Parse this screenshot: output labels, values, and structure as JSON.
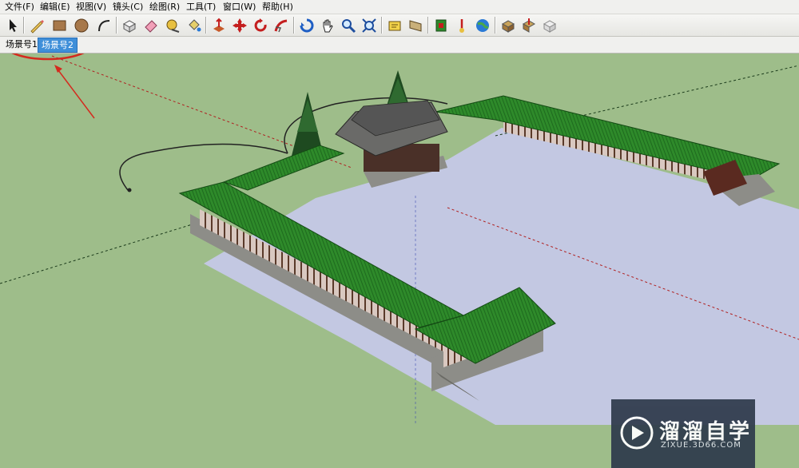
{
  "menu": [
    {
      "id": "file",
      "label": "文件(F)"
    },
    {
      "id": "edit",
      "label": "编辑(E)"
    },
    {
      "id": "view",
      "label": "视图(V)"
    },
    {
      "id": "camera",
      "label": "镜头(C)"
    },
    {
      "id": "draw",
      "label": "绘图(R)"
    },
    {
      "id": "tools",
      "label": "工具(T)"
    },
    {
      "id": "window",
      "label": "窗口(W)"
    },
    {
      "id": "help",
      "label": "帮助(H)"
    }
  ],
  "toolbar": {
    "tools": [
      {
        "name": "select-icon"
      },
      {
        "name": "pencil-line-icon"
      },
      {
        "name": "rectangle-icon"
      },
      {
        "name": "circle-icon"
      },
      {
        "name": "arc-icon"
      },
      {
        "name": "make-component-icon"
      },
      {
        "name": "eraser-icon"
      },
      {
        "name": "tape-measure-icon"
      },
      {
        "name": "paint-bucket-icon"
      },
      {
        "name": "push-pull-icon"
      },
      {
        "name": "move-icon"
      },
      {
        "name": "rotate-icon"
      },
      {
        "name": "follow-me-icon"
      },
      {
        "name": "orbit-icon"
      },
      {
        "name": "pan-icon"
      },
      {
        "name": "zoom-icon"
      },
      {
        "name": "zoom-extents-icon"
      },
      {
        "name": "position-camera-icon"
      },
      {
        "name": "look-around-icon"
      },
      {
        "name": "add-location-icon"
      },
      {
        "name": "toggle-terrain-icon"
      },
      {
        "name": "google-earth-icon"
      },
      {
        "name": "get-models-icon"
      },
      {
        "name": "share-model-icon"
      },
      {
        "name": "share-component-icon"
      }
    ]
  },
  "scenes": {
    "tabs": [
      {
        "label": "场景号1",
        "active": false
      },
      {
        "label": "场景号2",
        "active": true
      }
    ]
  },
  "viewport": {
    "ground_color": "#9ebd8a",
    "courtyard_color": "#c3c8e2",
    "roof_color": "#2e8a2a",
    "annotation_color": "#d42a1e"
  },
  "watermark": {
    "title": "溜溜自学",
    "url": "ZIXUE.3D66.COM"
  }
}
